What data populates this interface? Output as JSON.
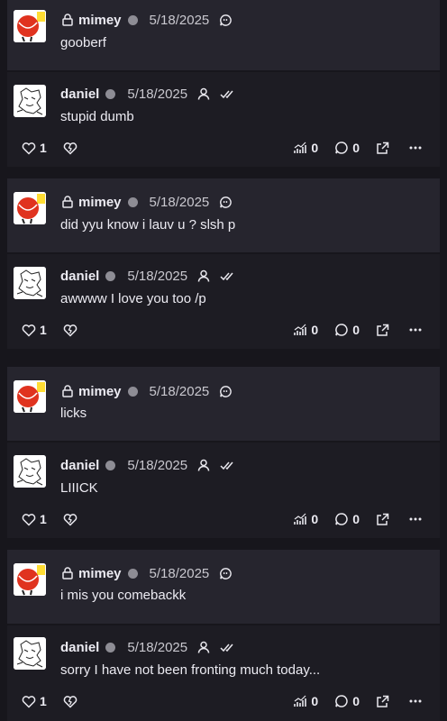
{
  "threads": [
    {
      "parent": {
        "author": "mimey",
        "date": "5/18/2025",
        "text": "gooberf"
      },
      "reply": {
        "author": "daniel",
        "date": "5/18/2025",
        "text": "stupid dumb",
        "likes": "1",
        "views": "0",
        "comments": "0"
      }
    },
    {
      "parent": {
        "author": "mimey",
        "date": "5/18/2025",
        "text": "did yyu know i lauv u ? slsh p"
      },
      "reply": {
        "author": "daniel",
        "date": "5/18/2025",
        "text": "awwww I love you too /p",
        "likes": "1",
        "views": "0",
        "comments": "0"
      }
    },
    {
      "parent": {
        "author": "mimey",
        "date": "5/18/2025",
        "text": "licks"
      },
      "reply": {
        "author": "daniel",
        "date": "5/18/2025",
        "text": "LIIICK",
        "likes": "1",
        "views": "0",
        "comments": "0"
      }
    },
    {
      "parent": {
        "author": "mimey",
        "date": "5/18/2025",
        "text": "i mis you comebackk"
      },
      "reply": {
        "author": "daniel",
        "date": "5/18/2025",
        "text": "sorry I have not been fronting much today...",
        "likes": "1",
        "views": "0",
        "comments": "0"
      }
    }
  ],
  "icons": {
    "lock": "lock-icon",
    "status": "status-dot",
    "quote": "quote-bubble-icon",
    "person": "person-icon",
    "double_check": "double-check-icon",
    "heart": "heart-icon",
    "broken_heart": "broken-heart-icon",
    "chart": "chart-icon",
    "comment": "comment-icon",
    "share": "external-link-icon",
    "more": "more-icon"
  },
  "colors": {
    "background": "#17161c",
    "parent_card": "#26252e",
    "reply_card": "#1d1c23",
    "status_dot": "#8e8d95"
  }
}
